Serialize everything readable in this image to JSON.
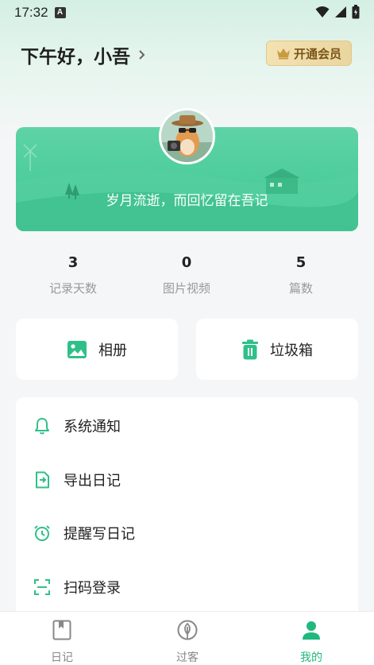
{
  "status_bar": {
    "time": "17:32",
    "notification_glyph": "A"
  },
  "header": {
    "greeting": "下午好，小吾",
    "vip_button": "开通会员"
  },
  "banner": {
    "quote": "岁月流逝，而回忆留在吾记"
  },
  "stats": [
    {
      "value": "3",
      "label": "记录天数"
    },
    {
      "value": "0",
      "label": "图片视频"
    },
    {
      "value": "5",
      "label": "篇数"
    }
  ],
  "quick_actions": [
    {
      "label": "相册",
      "icon": "photo-album-icon"
    },
    {
      "label": "垃圾箱",
      "icon": "trash-icon"
    }
  ],
  "menu": [
    {
      "label": "系统通知",
      "icon": "bell-icon"
    },
    {
      "label": "导出日记",
      "icon": "export-icon"
    },
    {
      "label": "提醒写日记",
      "icon": "alarm-clock-icon"
    },
    {
      "label": "扫码登录",
      "icon": "scan-icon"
    }
  ],
  "tabbar": [
    {
      "label": "日记",
      "icon": "diary-icon",
      "active": false
    },
    {
      "label": "过客",
      "icon": "leaf-icon",
      "active": false
    },
    {
      "label": "我的",
      "icon": "profile-icon",
      "active": true
    }
  ],
  "colors": {
    "accent": "#1fb97d",
    "banner": "#4ccc99",
    "vip_text": "#7a5418"
  }
}
